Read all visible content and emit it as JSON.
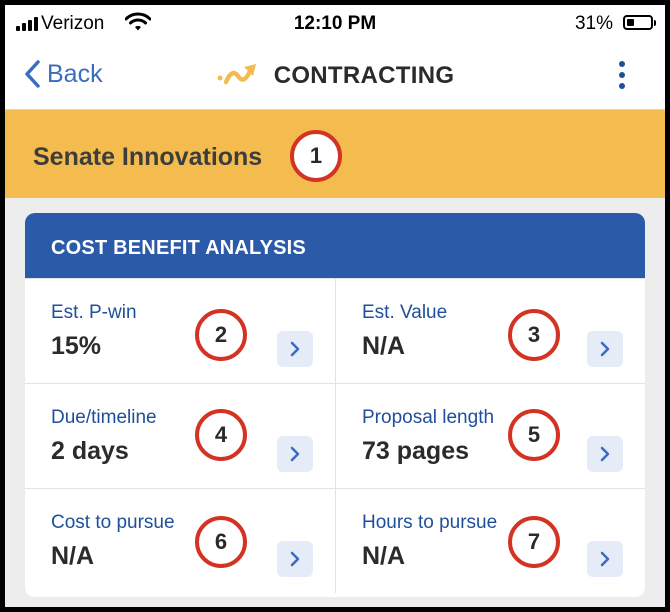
{
  "status_bar": {
    "carrier": "Verizon",
    "time": "12:10 PM",
    "battery_percent": "31%",
    "battery_level": 0.31
  },
  "nav": {
    "back_label": "Back",
    "title": "CONTRACTING",
    "logo_icon": "arrow-logo-icon",
    "menu_icon": "kebab-menu-icon"
  },
  "header": {
    "title": "Senate Innovations",
    "callout": "1"
  },
  "card": {
    "title": "COST BENEFIT ANALYSIS",
    "items": [
      {
        "label": "Est. P-win",
        "value": "15%",
        "callout": "2"
      },
      {
        "label": "Est. Value",
        "value": "N/A",
        "callout": "3"
      },
      {
        "label": "Due/timeline",
        "value": "2 days",
        "callout": "4"
      },
      {
        "label": "Proposal length",
        "value": "73 pages",
        "callout": "5"
      },
      {
        "label": "Cost to pursue",
        "value": "N/A",
        "callout": "6"
      },
      {
        "label": "Hours to pursue",
        "value": "N/A",
        "callout": "7"
      }
    ]
  },
  "colors": {
    "header_bg": "#f4bc4f",
    "card_header_bg": "#2b5aa8",
    "accent": "#1f4f9a",
    "callout_border": "#d43324"
  }
}
